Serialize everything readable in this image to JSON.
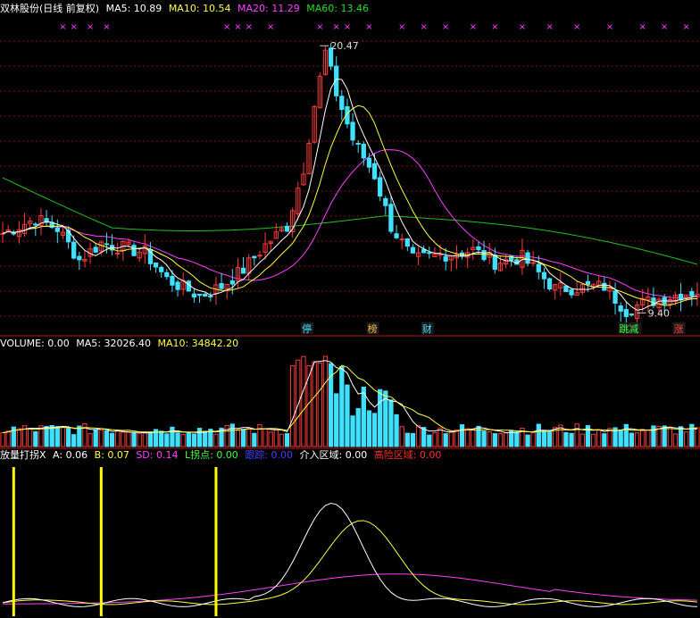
{
  "header": {
    "stock_title": "双林股份(日线 前复权)",
    "ma5_label": "MA5: 10.89",
    "ma10_label": "MA10: 10.54",
    "ma20_label": "MA20: 11.29",
    "ma60_label": "MA60: 13.46"
  },
  "volume_header": {
    "title": "VOLUME: 0.00",
    "ma5_label": "MA5: 32026.40",
    "ma10_label": "MA10: 34842.20"
  },
  "indicator_header": {
    "title": "放量打拐X",
    "a_label": "A: 0.06",
    "b_label": "B: 0.07",
    "sd_label": "SD: 0.14",
    "l_label": "L拐点: 0.00",
    "kuayue_label": "跟踪: 0.00",
    "jieru_label": "介入区域: 0.00",
    "risk_label": "高险区域: 0.00"
  },
  "colors": {
    "background": "#000000",
    "grid": "#8a1010",
    "up": "#ff3b3b",
    "down": "#40e0ff",
    "ma5": "#ffffff",
    "ma10": "#ffff40",
    "ma20": "#ff40ff",
    "ma60": "#20c020",
    "marker": "#ff40ff",
    "signal_bar": "#ffff00"
  },
  "chart_data": [
    {
      "type": "candlestick",
      "title": "双林股份(日线 前复权)",
      "ylim": [
        8.6,
        21.7
      ],
      "annotations": [
        {
          "text": "20.47",
          "value": 20.47
        },
        {
          "text": "9.40",
          "value": 9.4
        }
      ],
      "markers_top": "××",
      "bottom_labels": [
        {
          "text": "停",
          "color": "#40e0ff"
        },
        {
          "text": "榜",
          "color": "#ffbb44"
        },
        {
          "text": "财",
          "color": "#40e0ff"
        },
        {
          "text": "跳减",
          "color": "#40ff40"
        },
        {
          "text": "涨",
          "color": "#ff4040"
        }
      ]
    },
    {
      "type": "bar",
      "title": "VOLUME: 0.00",
      "series": [
        {
          "name": "MA5"
        },
        {
          "name": "MA10"
        }
      ]
    },
    {
      "type": "line",
      "title": "放量打拐X",
      "series": [
        {
          "name": "A"
        },
        {
          "name": "B"
        },
        {
          "name": "SD"
        }
      ]
    }
  ]
}
